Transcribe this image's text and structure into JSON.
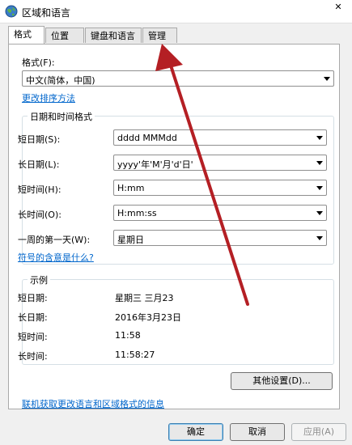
{
  "window": {
    "title": "区域和语言",
    "close_glyph": "✕"
  },
  "tabs": [
    {
      "label": "格式"
    },
    {
      "label": "位置"
    },
    {
      "label": "键盘和语言"
    },
    {
      "label": "管理"
    }
  ],
  "format": {
    "label": "格式(F):",
    "value": "中文(简体，中国)",
    "sort_link": "更改排序方法"
  },
  "datetime": {
    "group_title": "日期和时间格式",
    "rows": [
      {
        "label": "短日期(S):",
        "value": "dddd  MMMdd"
      },
      {
        "label": "长日期(L):",
        "value": "yyyy'年'M'月'd'日'"
      },
      {
        "label": "短时间(H):",
        "value": "H:mm"
      },
      {
        "label": "长时间(O):",
        "value": "H:mm:ss"
      },
      {
        "label": "一周的第一天(W):",
        "value": "星期日"
      }
    ],
    "symbol_link": "符号的含意是什么?"
  },
  "examples": {
    "group_title": "示例",
    "rows": [
      {
        "label": "短日期:",
        "value": "星期三  三月23"
      },
      {
        "label": "长日期:",
        "value": "2016年3月23日"
      },
      {
        "label": "短时间:",
        "value": "11:58"
      },
      {
        "label": "长时间:",
        "value": "11:58:27"
      }
    ]
  },
  "other_settings_button": "其他设置(D)...",
  "online_link": "联机获取更改语言和区域格式的信息",
  "buttons": {
    "ok": "确定",
    "cancel": "取消",
    "apply": "应用(A)"
  },
  "colors": {
    "link": "#0066cc",
    "annotation_arrow": "#b41f24"
  },
  "icons": {
    "window": "globe-icon",
    "close": "close-icon"
  }
}
